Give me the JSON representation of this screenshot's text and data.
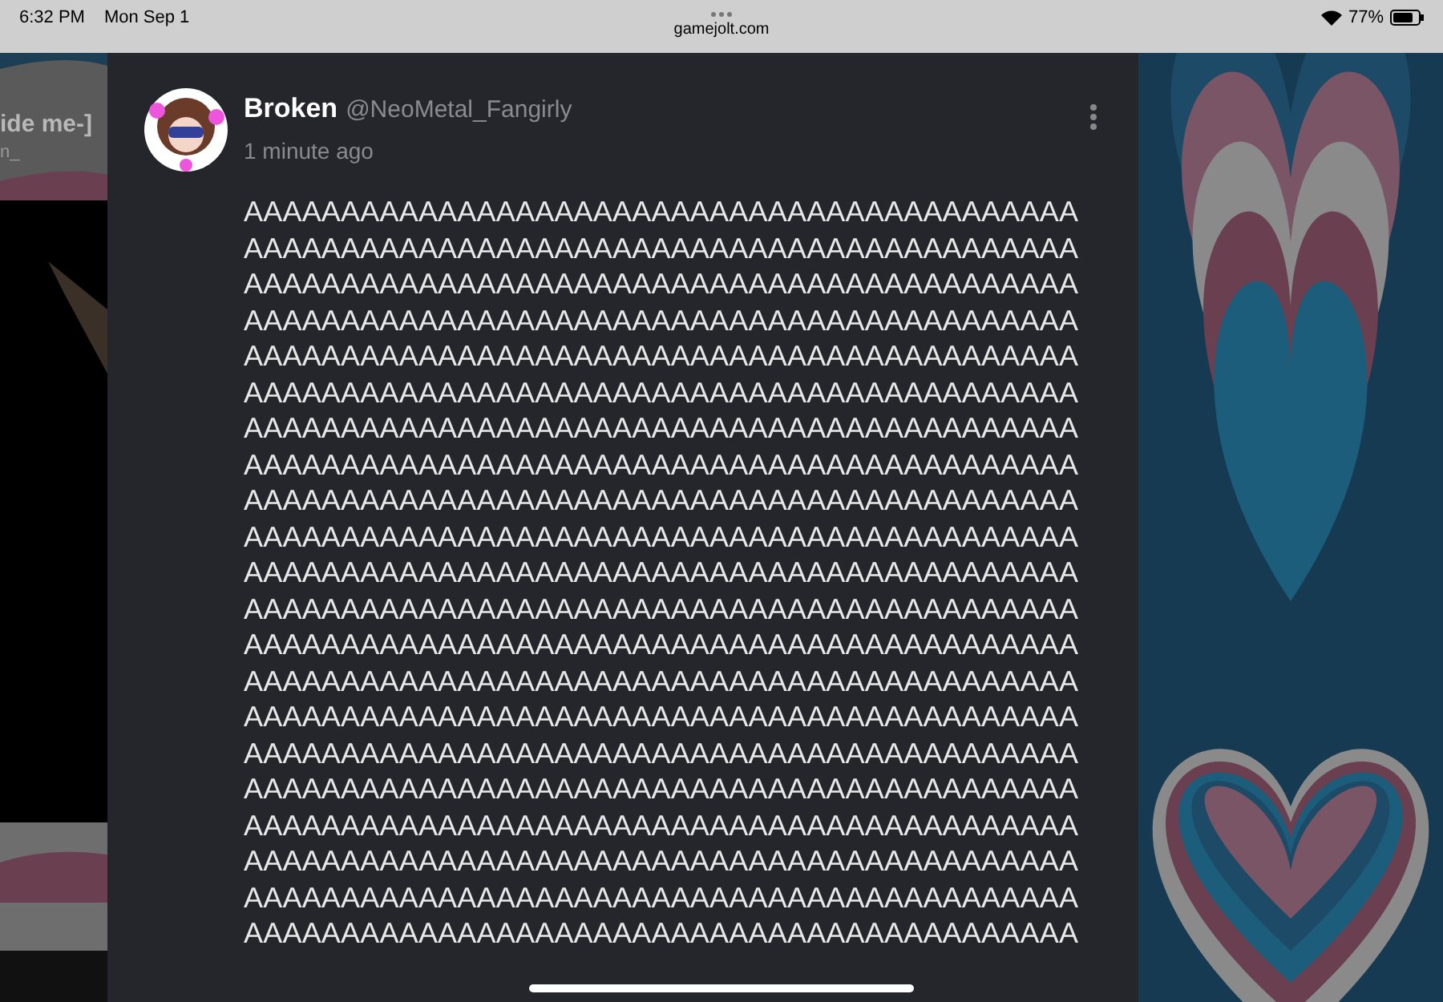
{
  "status_bar": {
    "time": "6:32 PM",
    "date": "Mon Sep 1",
    "url": "gamejolt.com",
    "battery": "77%"
  },
  "background": {
    "title": "ide me-]",
    "subtitle": "n_"
  },
  "post": {
    "display_name": "Broken",
    "username": "@NeoMetal_Fangirly",
    "time": "1 minute ago",
    "lines": [
      "AAAAAAAAAAAAAAAAAAAAAAAAAAAAAAAAAAAAAAAAAAA",
      "AAAAAAAAAAAAAAAAAAAAAAAAAAAAAAAAAAAAAAAAAAA",
      "AAAAAAAAAAAAAAAAAAAAAAAAAAAAAAAAAAAAAAAAAAA",
      "AAAAAAAAAAAAAAAAAAAAAAAAAAAAAAAAAAAAAAAAAAA",
      "AAAAAAAAAAAAAAAAAAAAAAAAAAAAAAAAAAAAAAAAAAA",
      "AAAAAAAAAAAAAAAAAAAAAAAAAAAAAAAAAAAAAAAAAAA",
      "AAAAAAAAAAAAAAAAAAAAAAAAAAAAAAAAAAAAAAAAAAA",
      "AAAAAAAAAAAAAAAAAAAAAAAAAAAAAAAAAAAAAAAAAAA",
      "AAAAAAAAAAAAAAAAAAAAAAAAAAAAAAAAAAAAAAAAAAA",
      "AAAAAAAAAAAAAAAAAAAAAAAAAAAAAAAAAAAAAAAAAAA",
      "AAAAAAAAAAAAAAAAAAAAAAAAAAAAAAAAAAAAAAAAAAA",
      "AAAAAAAAAAAAAAAAAAAAAAAAAAAAAAAAAAAAAAAAAAA",
      "AAAAAAAAAAAAAAAAAAAAAAAAAAAAAAAAAAAAAAAAAAA",
      "AAAAAAAAAAAAAAAAAAAAAAAAAAAAAAAAAAAAAAAAAAA",
      "AAAAAAAAAAAAAAAAAAAAAAAAAAAAAAAAAAAAAAAAAAA",
      "AAAAAAAAAAAAAAAAAAAAAAAAAAAAAAAAAAAAAAAAAAA",
      "AAAAAAAAAAAAAAAAAAAAAAAAAAAAAAAAAAAAAAAAAAA",
      "AAAAAAAAAAAAAAAAAAAAAAAAAAAAAAAAAAAAAAAAAAA",
      "AAAAAAAAAAAAAAAAAAAAAAAAAAAAAAAAAAAAAAAAAAA",
      "AAAAAAAAAAAAAAAAAAAAAAAAAAAAAAAAAAAAAAAAAAA",
      "AAAAAAAAAAAAAAAAAAAAAAAAAAAAAAAAAAAAAAAAAAA"
    ]
  }
}
